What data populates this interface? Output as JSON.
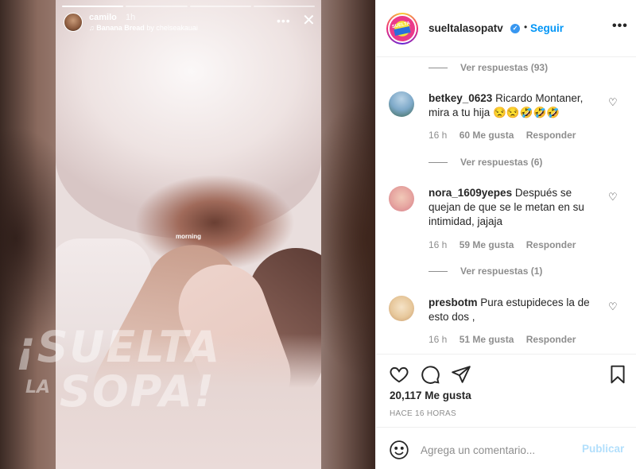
{
  "story": {
    "username": "camilo",
    "time": "1h",
    "music_title": "Banana Bread",
    "music_by": "by chelseakauai",
    "sticker_text": "morning",
    "more_icon": "more-horizontal-icon",
    "close_icon": "close-icon",
    "progress": {
      "segments": 4,
      "active_index": 0
    }
  },
  "watermark": {
    "line1": "¡SUELTA",
    "la": "LA",
    "line2": "SOPA!"
  },
  "post_header": {
    "username": "sueltalasopatv",
    "verified": true,
    "separator": "•",
    "follow_label": "Seguir",
    "more_label": "•••",
    "logo_text": "SUELTA"
  },
  "comments": {
    "view_replies": [
      "Ver respuestas (93)",
      "Ver respuestas (6)",
      "Ver respuestas (1)"
    ],
    "items": [
      {
        "username": "betkey_0623",
        "text": "Ricardo Montaner, mira a tu hija 😒😒🤣🤣🤣",
        "time": "16 h",
        "likes": "60 Me gusta",
        "reply": "Responder"
      },
      {
        "username": "nora_1609yepes",
        "text": "Después se quejan de que se le metan en su intimidad, jajaja",
        "time": "16 h",
        "likes": "59 Me gusta",
        "reply": "Responder"
      },
      {
        "username": "presbotm",
        "text": "Pura estupideces la de esto dos ,",
        "time": "16 h",
        "likes": "51 Me gusta",
        "reply": "Responder"
      }
    ]
  },
  "actions": {
    "likes": "20,117 Me gusta",
    "posted": "HACE 16 HORAS",
    "comment_placeholder": "Agrega un comentario...",
    "publish_label": "Publicar"
  },
  "colors": {
    "accent": "#0095f6",
    "verified": "#3897f0",
    "muted": "#8e8e8e",
    "publish_disabled": "#b2dffc"
  }
}
